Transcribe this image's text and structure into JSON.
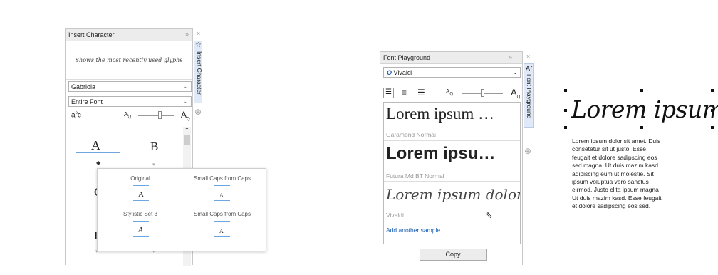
{
  "insert_character": {
    "title": "Insert Character",
    "recent_hint": "Shows the most recently used glyphs",
    "font_value": "Gabriola",
    "range_value": "Entire Font",
    "side_tab": "Insert Character",
    "grid_glyphs": [
      "A",
      "B",
      "C",
      "D"
    ],
    "popup": {
      "items": [
        {
          "label": "Original",
          "glyph": "A"
        },
        {
          "label": "Small Caps from Caps",
          "glyph": "A"
        },
        {
          "label": "Stylistic Set 3",
          "glyph": "A"
        },
        {
          "label": "Small Caps from Caps",
          "glyph": "A"
        }
      ]
    }
  },
  "font_playground": {
    "title": "Font Playground",
    "font_value": "Vivaldi",
    "side_tab": "Font Playground",
    "samples": [
      {
        "text": "Lorem ipsum …",
        "font_name": "Garamond Normal"
      },
      {
        "text": "Lorem ipsu…",
        "font_name": "Futura Md BT Normal"
      },
      {
        "text": "Lorem ipsum dolor…",
        "font_name": "Vivaldi"
      }
    ],
    "add_sample": "Add another sample",
    "copy_label": "Copy"
  },
  "canvas": {
    "heading": "Lorem ipsum",
    "body_lines": [
      "Lorem ipsum dolor sit amet. Duis",
      "consetetur sit ut justo. Esse",
      "feugait et dolore sadipscing eos",
      "sed magna. Ut duis mazim kasd",
      "adipiscing eum ut molestie. Sit",
      "ipsum voluptua vero sanctus",
      "eirmod. Justo clita ipsum magna",
      "Ut duis mazim kasd. Esse feugait",
      "et dolore sadipscing eos sed."
    ]
  },
  "colors": {
    "accent_blue": "#6fa6e0",
    "link_blue": "#1a5fb4",
    "tab_blue": "#dfe9f7"
  }
}
